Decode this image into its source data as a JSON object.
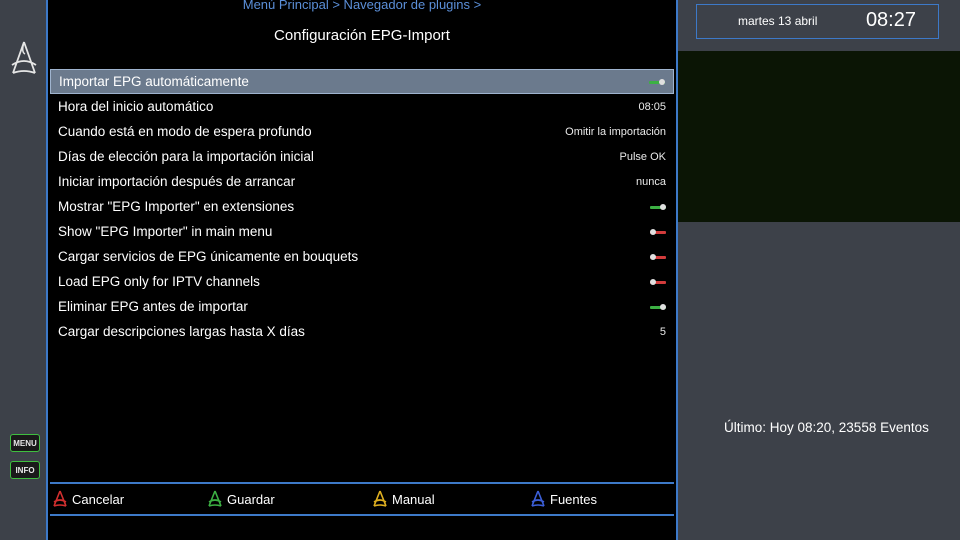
{
  "header": {
    "breadcrumb": "Menú Principal > Navegador de plugins >",
    "title": "Configuración EPG-Import"
  },
  "settings": [
    {
      "label": "Importar EPG automáticamente",
      "type": "toggle",
      "on": true,
      "selected": true
    },
    {
      "label": "Hora del inicio automático",
      "type": "text",
      "value": "08:05"
    },
    {
      "label": "Cuando está en modo de espera profundo",
      "type": "text",
      "value": "Omitir la importación"
    },
    {
      "label": "Días de elección para la importación inicial",
      "type": "text",
      "value": "Pulse OK"
    },
    {
      "label": "Iniciar importación después de arrancar",
      "type": "text",
      "value": "nunca"
    },
    {
      "label": "Mostrar \"EPG Importer\" en extensiones",
      "type": "toggle",
      "on": true
    },
    {
      "label": "Show \"EPG Importer\" in main menu",
      "type": "toggle",
      "on": false
    },
    {
      "label": "Cargar servicios de EPG únicamente en bouquets",
      "type": "toggle",
      "on": false
    },
    {
      "label": "Load EPG only for IPTV channels",
      "type": "toggle",
      "on": false
    },
    {
      "label": "Eliminar EPG antes de importar",
      "type": "toggle",
      "on": true
    },
    {
      "label": "Cargar descripciones largas hasta X días",
      "type": "text",
      "value": "5"
    }
  ],
  "keys": {
    "menu": "MENU",
    "info": "INFO"
  },
  "buttons": [
    {
      "label": "Cancelar",
      "color": "#d32f2f"
    },
    {
      "label": "Guardar",
      "color": "#3cb043"
    },
    {
      "label": "Manual",
      "color": "#e0b020"
    },
    {
      "label": "Fuentes",
      "color": "#3c5fd8"
    }
  ],
  "clock": {
    "date": "martes 13 abril",
    "time": "08:27"
  },
  "status": "Último: Hoy 08:20, 23558 Eventos",
  "colors": {
    "accent": "#3d79c8",
    "panel": "#3d4149",
    "toggle_on": "#3cb043",
    "toggle_off": "#d23b3b",
    "selection": "#6b7a8d"
  }
}
